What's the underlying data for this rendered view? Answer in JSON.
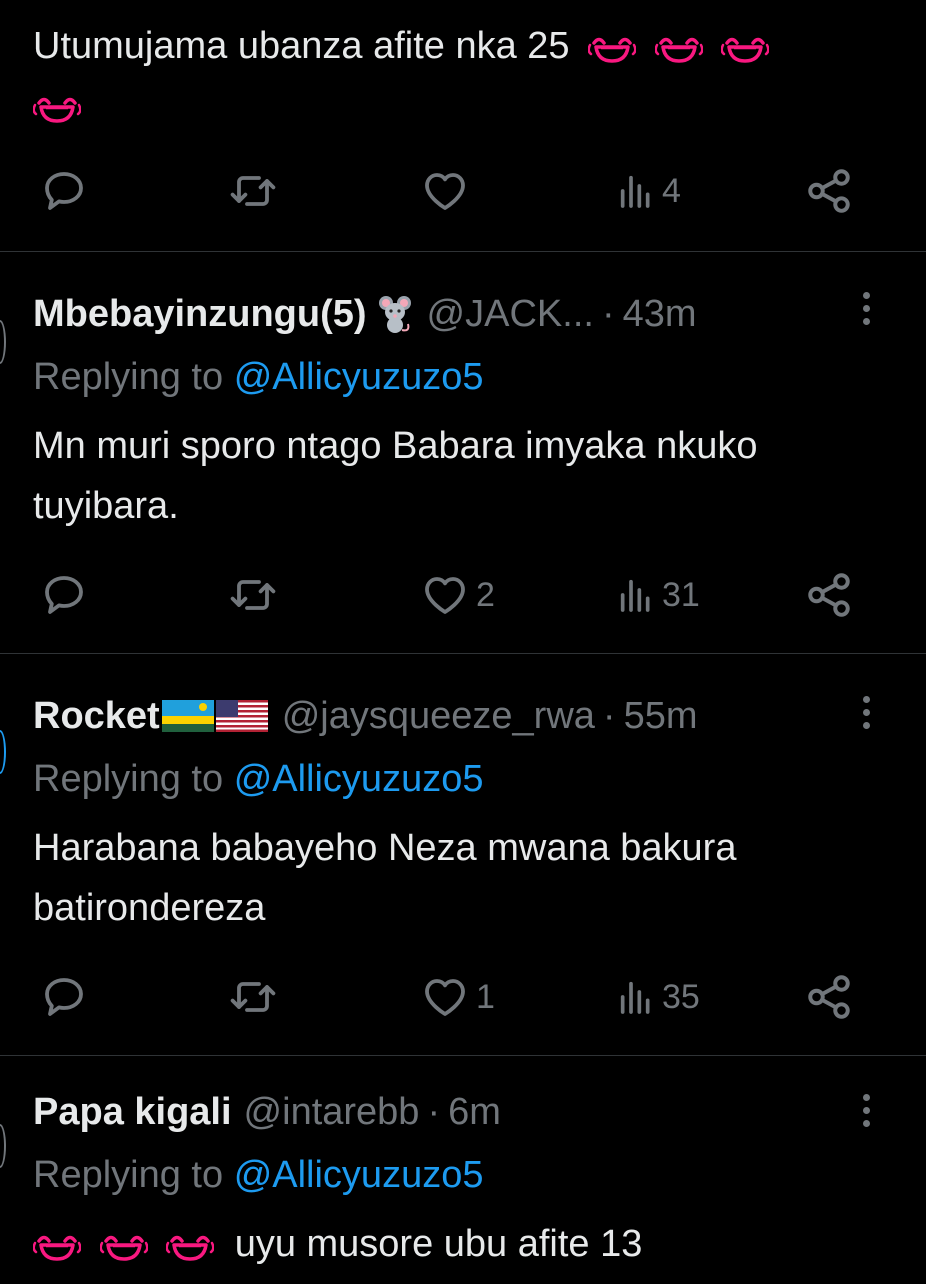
{
  "tweet0": {
    "text": "Utumujama ubanza afite nka 25",
    "emoji": "laughing-face",
    "stats": {
      "replies": "",
      "retweets": "",
      "likes": "",
      "views": "4"
    }
  },
  "tweets": [
    {
      "name": "Mbebayinzungu(5)",
      "name_emoji": "mouse",
      "handle": "@JACK...",
      "dot": "·",
      "time": "43m",
      "reply_prefix": "Replying to",
      "reply_to": "@Allicyuzuzo5",
      "text": "Mn muri sporo ntago Babara imyaka nkuko tuyibara.",
      "stats": {
        "replies": "",
        "retweets": "",
        "likes": "2",
        "views": "31"
      }
    },
    {
      "name": "Rocket",
      "name_emoji": "flags-rwanda-usa",
      "handle": "@jaysqueeze_rwa",
      "dot": "·",
      "time": "55m",
      "reply_prefix": "Replying to",
      "reply_to": "@Allicyuzuzo5",
      "text": "Harabana babayeho Neza mwana bakura batirondereza",
      "stats": {
        "replies": "",
        "retweets": "",
        "likes": "1",
        "views": "35"
      }
    },
    {
      "name": "Papa kigali",
      "handle": "@intarebb",
      "dot": "·",
      "time": "6m",
      "reply_prefix": "Replying to",
      "reply_to": "@Allicyuzuzo5",
      "text": "uyu musore ubu afite 13",
      "text_emoji": "laughing-face"
    }
  ],
  "colors": {
    "background": "#000000",
    "text": "#e7e9ea",
    "muted": "#71767b",
    "link": "#1d9bf0",
    "divider": "#2f3336",
    "emoji": "#f91880"
  }
}
